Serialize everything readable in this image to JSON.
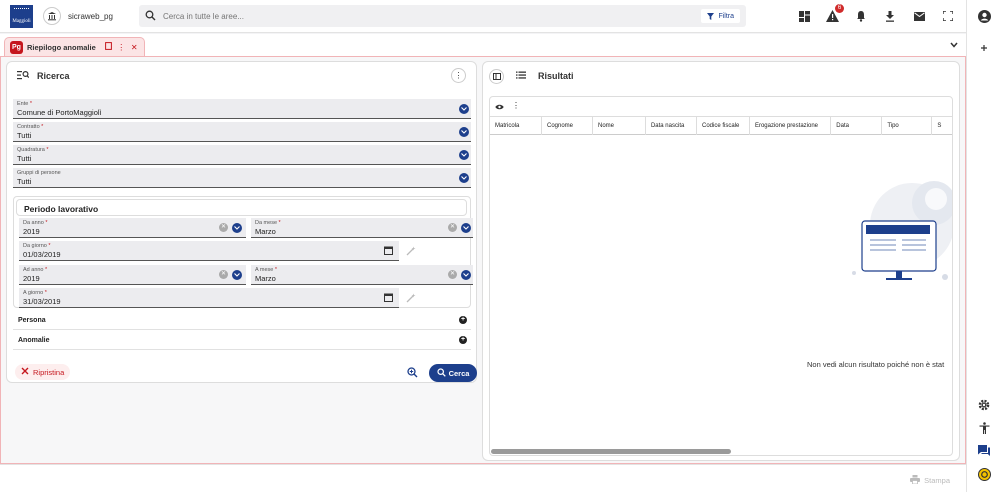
{
  "header": {
    "logo_text": "Maggioli",
    "app_name": "sicraweb_pg",
    "search_placeholder": "Cerca in tutte le aree...",
    "filter_label": "Filtra",
    "alerts_count": "6"
  },
  "tab": {
    "logo_text": "Pg",
    "title": "Riepilogo anomalie"
  },
  "search_panel": {
    "title": "Ricerca",
    "fields": {
      "ente": {
        "label": "Ente",
        "value": "Comune di PortoMaggiolì"
      },
      "contratto": {
        "label": "Contratto",
        "value": "Tutti"
      },
      "quadratura": {
        "label": "Quadratura",
        "value": "Tutti"
      },
      "gruppi": {
        "label": "Gruppi di persone",
        "value": "Tutti"
      }
    },
    "period": {
      "title": "Periodo lavorativo",
      "da_anno": {
        "label": "Da anno",
        "value": "2019"
      },
      "da_mese": {
        "label": "Da mese",
        "value": "Marzo"
      },
      "da_giorno": {
        "label": "Da giorno",
        "value": "01/03/2019"
      },
      "ad_anno": {
        "label": "Ad anno",
        "value": "2019"
      },
      "a_mese": {
        "label": "A mese",
        "value": "Marzo"
      },
      "a_giorno": {
        "label": "A giorno",
        "value": "31/03/2019"
      }
    },
    "sections": [
      "Persona",
      "Anomalie"
    ],
    "reset_label": "Ripristina",
    "search_label": "Cerca"
  },
  "results_panel": {
    "title": "Risultati",
    "columns": [
      "Matricola",
      "Cognome",
      "Nome",
      "Data nascita",
      "Codice fiscale",
      "Erogazione prestazione",
      "Data",
      "Tipo",
      "S"
    ],
    "empty_message": "Non vedi alcun risultato poiché non è stat"
  },
  "footer": {
    "print_label": "Stampa"
  },
  "colors": {
    "primary": "#1d3f8c",
    "accent_red": "#c5161d",
    "tab_bg": "#fbe4e5"
  },
  "icons": [
    "search-icon",
    "filter-icon",
    "dashboard-icon",
    "alert-icon",
    "bell-icon",
    "download-icon",
    "mail-icon",
    "fullscreen-icon",
    "user-icon",
    "plus-icon",
    "gear-icon",
    "accessibility-icon",
    "chat-icon",
    "help-icon"
  ]
}
